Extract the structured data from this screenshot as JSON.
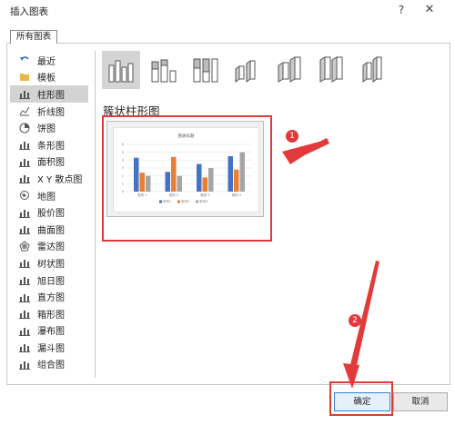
{
  "window": {
    "title": "插入图表",
    "help_glyph": "?",
    "close_glyph": "✕"
  },
  "tabs": [
    {
      "label": "所有图表"
    }
  ],
  "sidebar": {
    "items": [
      {
        "label": "最近",
        "icon": "undo-icon"
      },
      {
        "label": "模板",
        "icon": "folder-icon"
      },
      {
        "label": "柱形图",
        "icon": "column-chart-icon",
        "selected": true
      },
      {
        "label": "折线图",
        "icon": "line-chart-icon"
      },
      {
        "label": "饼图",
        "icon": "pie-chart-icon"
      },
      {
        "label": "条形图",
        "icon": "bar-chart-icon"
      },
      {
        "label": "面积图",
        "icon": "area-chart-icon"
      },
      {
        "label": "X Y 散点图",
        "icon": "scatter-chart-icon"
      },
      {
        "label": "地图",
        "icon": "map-chart-icon"
      },
      {
        "label": "股价图",
        "icon": "stock-chart-icon"
      },
      {
        "label": "曲面图",
        "icon": "surface-chart-icon"
      },
      {
        "label": "雷达图",
        "icon": "radar-chart-icon"
      },
      {
        "label": "树状图",
        "icon": "treemap-chart-icon"
      },
      {
        "label": "旭日图",
        "icon": "sunburst-chart-icon"
      },
      {
        "label": "直方图",
        "icon": "histogram-chart-icon"
      },
      {
        "label": "箱形图",
        "icon": "box-whisker-chart-icon"
      },
      {
        "label": "瀑布图",
        "icon": "waterfall-chart-icon"
      },
      {
        "label": "漏斗图",
        "icon": "funnel-chart-icon"
      },
      {
        "label": "组合图",
        "icon": "combo-chart-icon"
      }
    ]
  },
  "subtypes": [
    {
      "icon": "clustered-column-icon",
      "selected": true
    },
    {
      "icon": "stacked-column-icon"
    },
    {
      "icon": "stacked-100-column-icon"
    },
    {
      "icon": "3d-clustered-column-icon"
    },
    {
      "icon": "3d-stacked-column-icon"
    },
    {
      "icon": "3d-stacked-100-column-icon"
    },
    {
      "icon": "3d-column-icon"
    }
  ],
  "selected_heading": "簇状柱形图",
  "preview": {
    "title": "图表标题",
    "chart_data": {
      "type": "bar",
      "title": "图表标题",
      "categories": [
        "类别 1",
        "类别 2",
        "类别 3",
        "类别 4"
      ],
      "series": [
        {
          "name": "系列1",
          "values": [
            4.3,
            2.5,
            3.5,
            4.5
          ],
          "color": "#4472c4"
        },
        {
          "name": "系列2",
          "values": [
            2.4,
            4.4,
            1.8,
            2.8
          ],
          "color": "#ed7d31"
        },
        {
          "name": "系列3",
          "values": [
            2.0,
            2.0,
            3.0,
            5.0
          ],
          "color": "#a5a5a5"
        }
      ],
      "ylim": [
        0,
        6
      ],
      "yticks": [
        "0",
        "1",
        "2",
        "3",
        "4",
        "5",
        "6"
      ],
      "grid": true,
      "legend": "bottom"
    }
  },
  "annotations": {
    "badge1": "1",
    "badge2": "2",
    "arrow_color": "#e23a3a"
  },
  "buttons": {
    "ok": "确定",
    "cancel": "取消"
  },
  "colors": {
    "accent": "#3c7fd1",
    "highlight": "#e23a3a"
  }
}
